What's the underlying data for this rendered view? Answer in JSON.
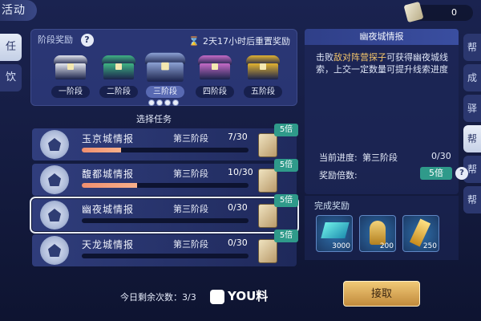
{
  "top_tab": "活动",
  "coins": "0",
  "left_tabs": [
    "任",
    "饮"
  ],
  "right_tabs": [
    "帮",
    "成",
    "驿",
    "帮",
    "帮",
    "帮"
  ],
  "stage_panel": {
    "title": "阶段奖励",
    "help": "?",
    "reset": "2天17小时后重置奖励",
    "stages": [
      {
        "label": "一阶段",
        "color": "#e3e6ef"
      },
      {
        "label": "二阶段",
        "color": "#3fb384"
      },
      {
        "label": "三阶段",
        "color": "#8ea3d6"
      },
      {
        "label": "四阶段",
        "color": "#c56bc7"
      },
      {
        "label": "五阶段",
        "color": "#e2b331"
      }
    ]
  },
  "select_title": "选择任务",
  "tasks": [
    {
      "name": "玉京城情报",
      "stage": "第三阶段",
      "progress": "7/30",
      "ratio": 0.2333,
      "mult": "5倍"
    },
    {
      "name": "馥都城情报",
      "stage": "第三阶段",
      "progress": "10/30",
      "ratio": 0.3333,
      "mult": "5倍"
    },
    {
      "name": "幽夜城情报",
      "stage": "第三阶段",
      "progress": "0/30",
      "ratio": 0,
      "mult": "5倍"
    },
    {
      "name": "天龙城情报",
      "stage": "第三阶段",
      "progress": "0/30",
      "ratio": 0,
      "mult": "5倍"
    }
  ],
  "remain_text": "今日剩余次数：3/3",
  "logo_text": "YOU料",
  "detail": {
    "title": "幽夜城情报",
    "desc_prefix": "击败",
    "desc_highlight": "敌对阵营探子",
    "desc_suffix": "可获得幽夜城线索，上交一定数量可提升线索进度",
    "progress_label": "当前进度:",
    "progress_stage": "第三阶段",
    "progress_value": "0/30",
    "mult_label": "奖励倍数:",
    "mult_value": "5倍",
    "help": "?"
  },
  "complete": {
    "title": "完成奖励",
    "rewards": [
      "3000",
      "200",
      "250"
    ]
  },
  "claim_label": "接取"
}
